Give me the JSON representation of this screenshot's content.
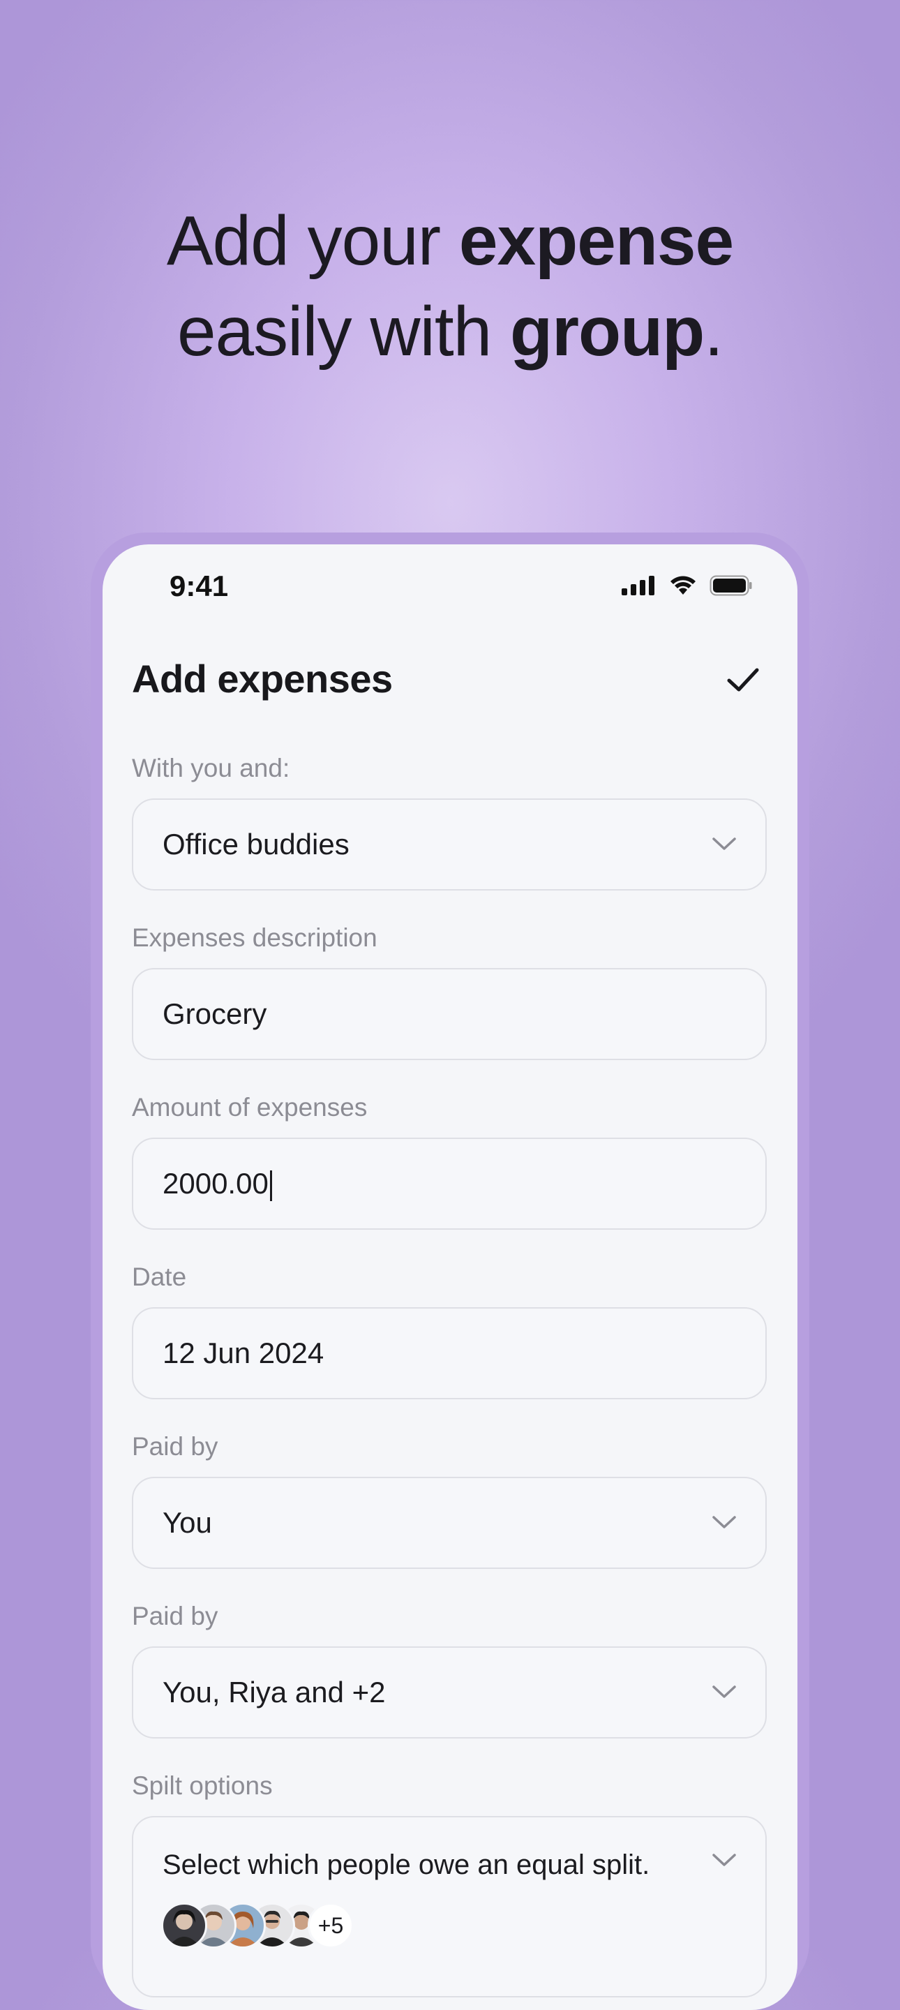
{
  "headline": {
    "line1_regular": "Add your ",
    "line1_bold": "expense",
    "line2_regular": "easily with ",
    "line2_bold": "group",
    "line2_end": "."
  },
  "status_bar": {
    "time": "9:41",
    "icons": [
      "cellular-signal-icon",
      "wifi-icon",
      "battery-icon"
    ]
  },
  "screen": {
    "title": "Add expenses",
    "confirm_icon": "checkmark-icon"
  },
  "fields": {
    "group": {
      "label": "With you and:",
      "value": "Office buddies",
      "icon": "chevron-down-icon"
    },
    "description": {
      "label": "Expenses description",
      "value": "Grocery"
    },
    "amount": {
      "label": "Amount of expenses",
      "value": "2000.00"
    },
    "date": {
      "label": "Date",
      "value": "12 Jun 2024"
    },
    "paid_by": {
      "label": "Paid by",
      "value": "You",
      "icon": "chevron-down-icon"
    },
    "paid_by_2": {
      "label": "Paid by",
      "value": "You, Riya and +2",
      "icon": "chevron-down-icon"
    },
    "split": {
      "label": "Spilt options",
      "value": "Select which people owe an equal split.",
      "icon": "chevron-down-icon",
      "extra_count": "+5"
    }
  },
  "colors": {
    "background": "#c8b2ea",
    "phone_frame": "#b79fdf",
    "screen": "#f5f6f9",
    "text_primary": "#1b1b1f",
    "text_label": "#8c8c94",
    "field_border": "#dedfe5"
  }
}
